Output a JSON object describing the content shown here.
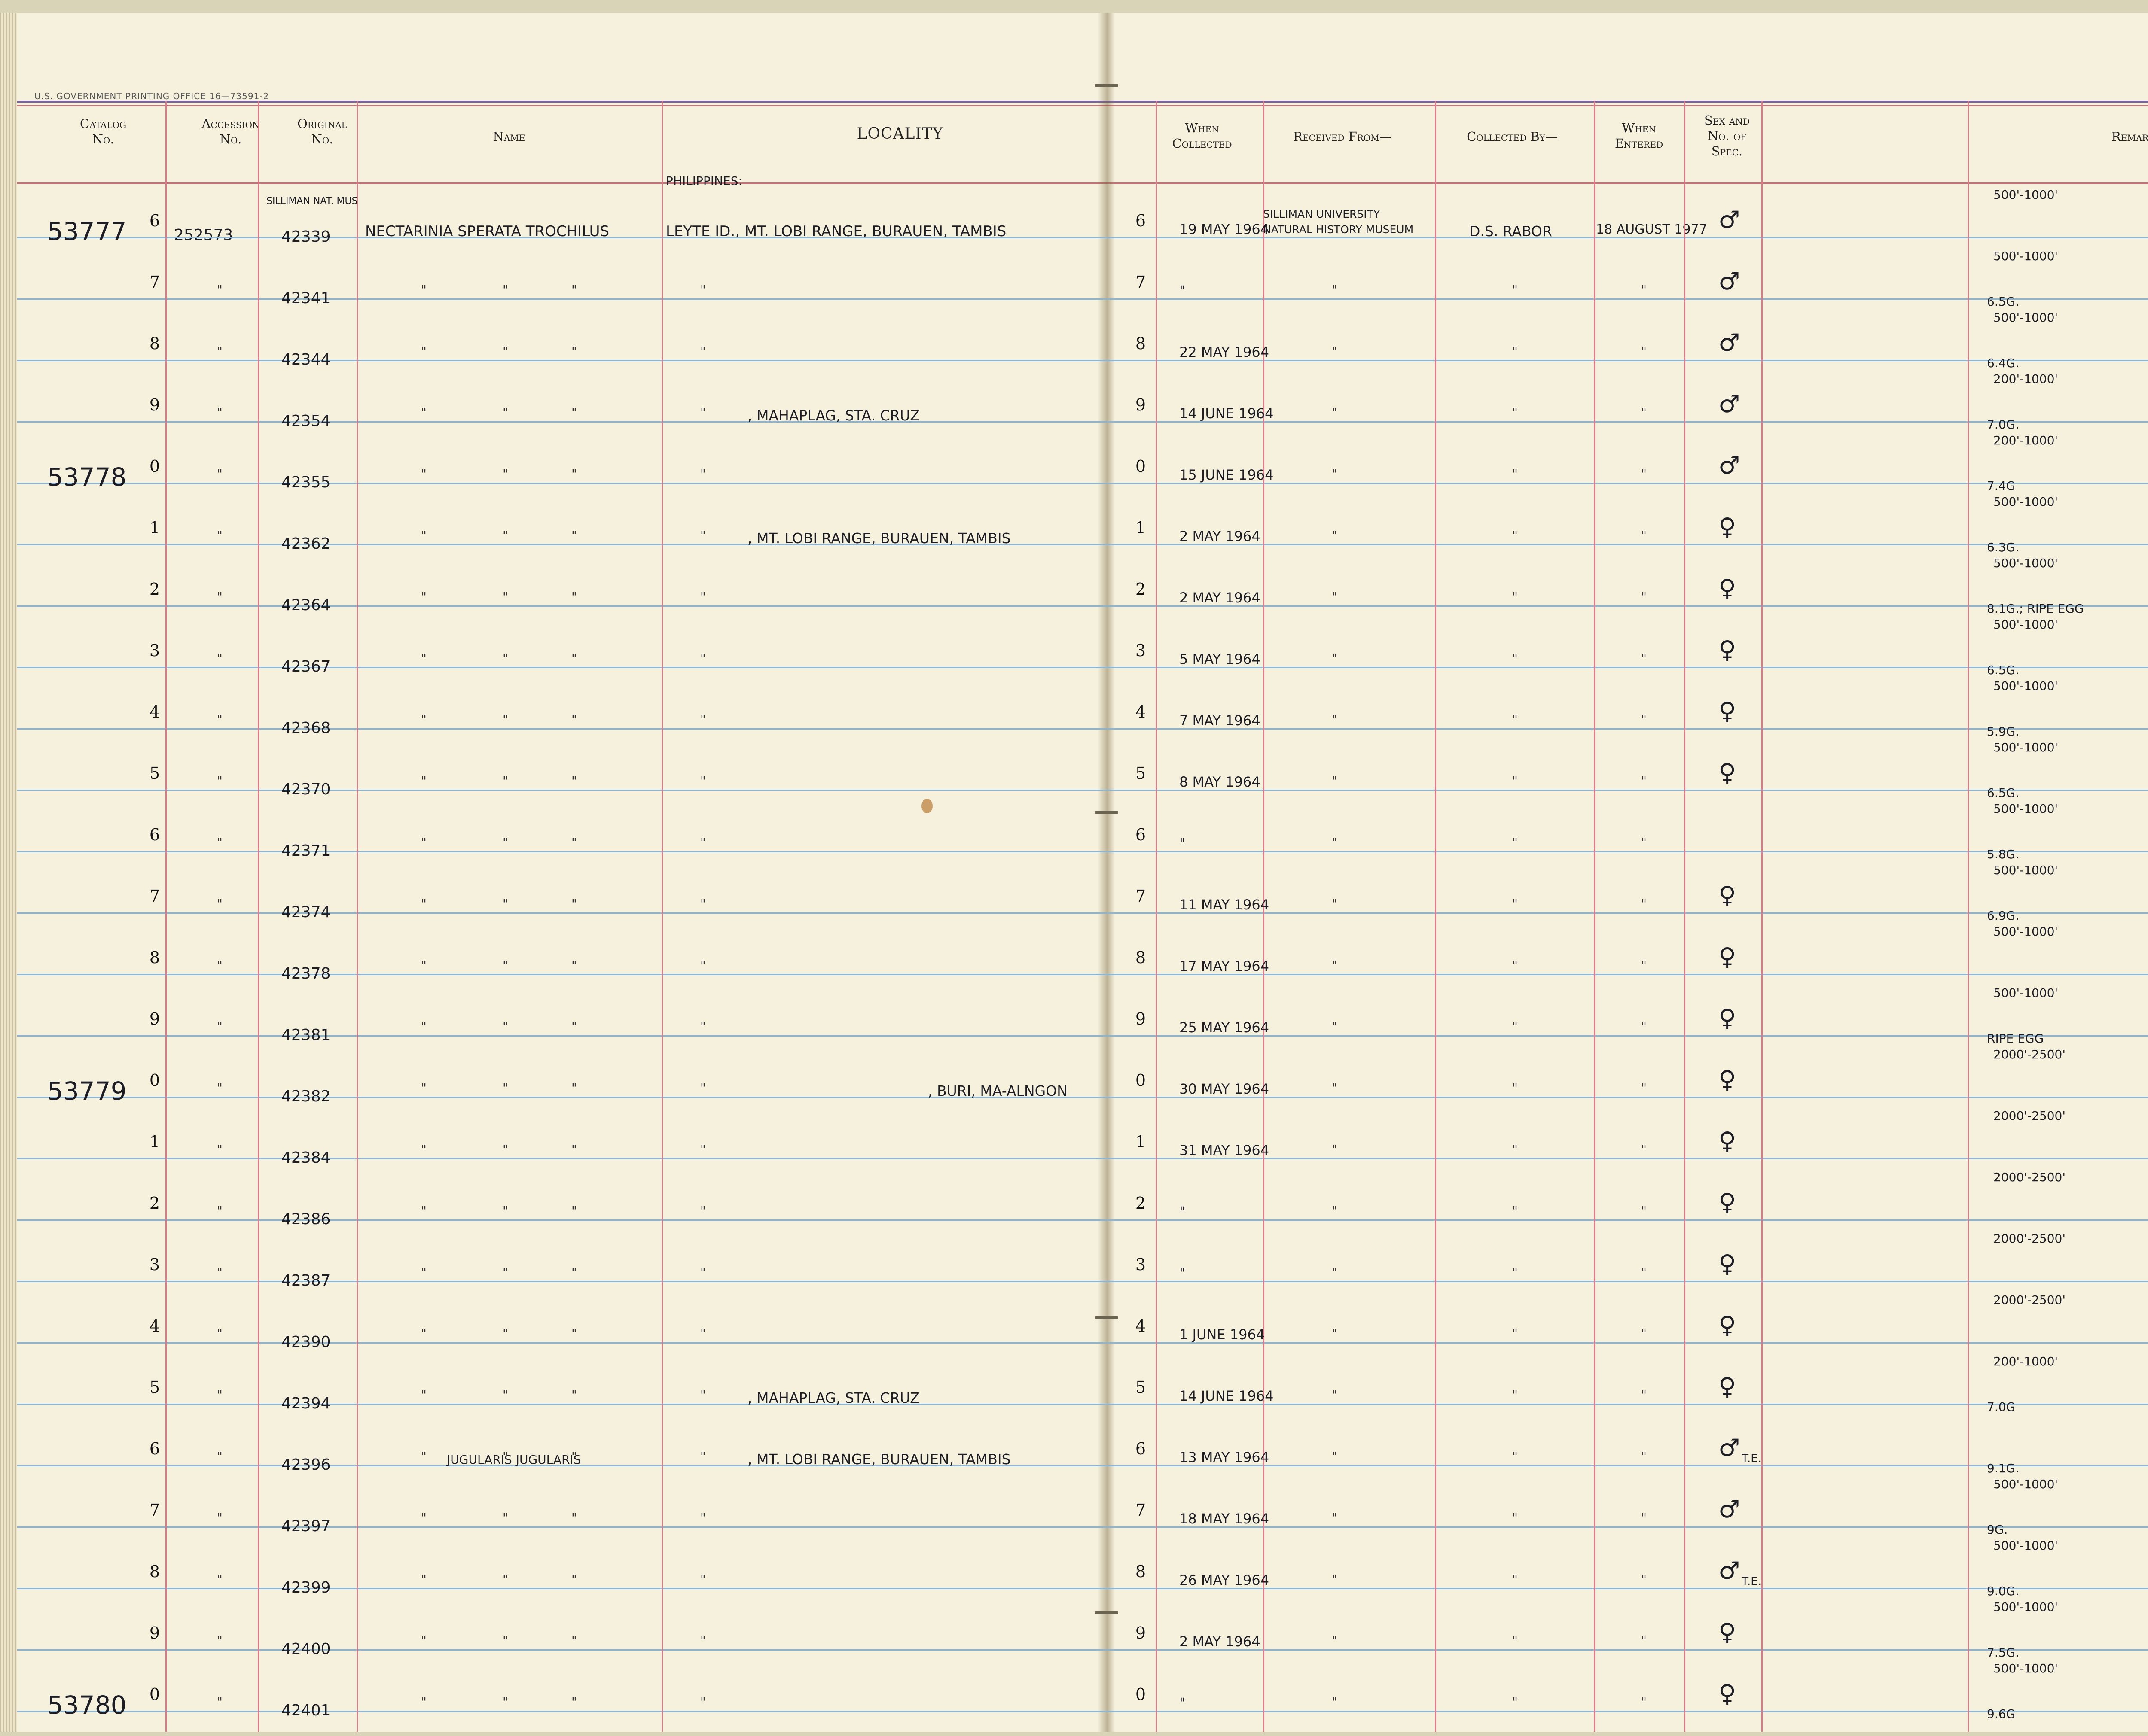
{
  "printer_line": "U.S. GOVERNMENT PRINTING OFFICE   16—73591-2",
  "headers": {
    "catalog": "Catalog\nNo.",
    "accession": "Accession\nNo.",
    "original": "Original\nNo.",
    "name": "Name",
    "locality": "LOCALITY",
    "when_collected": "When\nCollected",
    "received_from": "Received From—",
    "collected_by": "Collected By—",
    "when_entered": "When\nEntered",
    "sex": "Sex and\nNo. of\nSpec.",
    "remarks": "Remarks"
  },
  "top_notes": {
    "original_header_note": "SILLIMAN NAT. MUS",
    "locality_header_note": "PHILIPPINES:"
  },
  "first_row": {
    "accession": "252573",
    "name": "NECTARINIA SPERATA TROCHILUS",
    "locality": "LEYTE ID., MT. LOBI RANGE, BURAUEN, TAMBIS",
    "received_from_line1": "SILLIMAN UNIVERSITY",
    "received_from_line2": "NATURAL HISTORY MUSEUM",
    "collected_by": "D.S. RABOR",
    "when_entered": "18 AUGUST 1977"
  },
  "catalog_groups": [
    {
      "prefix": "53777",
      "row": 0
    },
    {
      "prefix": "53778",
      "row": 4
    },
    {
      "prefix": "53779",
      "row": 14
    },
    {
      "prefix": "53780",
      "row": 24
    }
  ],
  "locality_notes": [
    {
      "row": 3,
      "text": ", MAHAPLAG, STA. CRUZ"
    },
    {
      "row": 5,
      "text": ", MT. LOBI RANGE, BURAUEN, TAMBIS"
    },
    {
      "row": 14,
      "text": ", BURI, MA-ALNGON"
    },
    {
      "row": 19,
      "text": ", MAHAPLAG, STA. CRUZ"
    },
    {
      "row": 20,
      "text": ", MT. LOBI RANGE, BURAUEN, TAMBIS"
    }
  ],
  "name_notes": [
    {
      "row": 20,
      "text": "JUGULARIS    JUGULARIS"
    }
  ],
  "ditto_mark": "\"",
  "rows": [
    {
      "digit": "6",
      "original": "42339",
      "when_collected": "19 MAY 1964",
      "sex": "♂",
      "te": "",
      "remarks_top": "500'-1000'",
      "remarks": ""
    },
    {
      "digit": "7",
      "original": "42341",
      "when_collected": "\"",
      "sex": "♂",
      "te": "",
      "remarks_top": "500'-1000'",
      "remarks": "6.5G."
    },
    {
      "digit": "8",
      "original": "42344",
      "when_collected": "22 MAY 1964",
      "sex": "♂",
      "te": "",
      "remarks_top": "500'-1000'",
      "remarks": "6.4G."
    },
    {
      "digit": "9",
      "original": "42354",
      "when_collected": "14 JUNE 1964",
      "sex": "♂",
      "te": "",
      "remarks_top": "200'-1000'",
      "remarks": "7.0G."
    },
    {
      "digit": "0",
      "original": "42355",
      "when_collected": "15 JUNE 1964",
      "sex": "♂",
      "te": "",
      "remarks_top": "200'-1000'",
      "remarks": "7.4G"
    },
    {
      "digit": "1",
      "original": "42362",
      "when_collected": "2 MAY 1964",
      "sex": "♀",
      "te": "",
      "remarks_top": "500'-1000'",
      "remarks": "6.3G."
    },
    {
      "digit": "2",
      "original": "42364",
      "when_collected": "2 MAY 1964",
      "sex": "♀",
      "te": "",
      "remarks_top": "500'-1000'",
      "remarks": "8.1G.; RIPE EGG"
    },
    {
      "digit": "3",
      "original": "42367",
      "when_collected": "5 MAY 1964",
      "sex": "♀",
      "te": "",
      "remarks_top": "500'-1000'",
      "remarks": "6.5G."
    },
    {
      "digit": "4",
      "original": "42368",
      "when_collected": "7 MAY 1964",
      "sex": "♀",
      "te": "",
      "remarks_top": "500'-1000'",
      "remarks": "5.9G."
    },
    {
      "digit": "5",
      "original": "42370",
      "when_collected": "8 MAY 1964",
      "sex": "♀",
      "te": "",
      "remarks_top": "500'-1000'",
      "remarks": "6.5G."
    },
    {
      "digit": "6",
      "original": "42371",
      "when_collected": "\"",
      "sex": "",
      "te": "",
      "remarks_top": "500'-1000'",
      "remarks": "5.8G."
    },
    {
      "digit": "7",
      "original": "42374",
      "when_collected": "11 MAY 1964",
      "sex": "♀",
      "te": "",
      "remarks_top": "500'-1000'",
      "remarks": "6.9G."
    },
    {
      "digit": "8",
      "original": "42378",
      "when_collected": "17 MAY 1964",
      "sex": "♀",
      "te": "",
      "remarks_top": "500'-1000'",
      "remarks": ""
    },
    {
      "digit": "9",
      "original": "42381",
      "when_collected": "25 MAY 1964",
      "sex": "♀",
      "te": "",
      "remarks_top": "500'-1000'",
      "remarks": "RIPE EGG"
    },
    {
      "digit": "0",
      "original": "42382",
      "when_collected": "30 MAY 1964",
      "sex": "♀",
      "te": "",
      "remarks_top": "2000'-2500'",
      "remarks": ""
    },
    {
      "digit": "1",
      "original": "42384",
      "when_collected": "31 MAY 1964",
      "sex": "♀",
      "te": "",
      "remarks_top": "2000'-2500'",
      "remarks": ""
    },
    {
      "digit": "2",
      "original": "42386",
      "when_collected": "\"",
      "sex": "♀",
      "te": "",
      "remarks_top": "2000'-2500'",
      "remarks": ""
    },
    {
      "digit": "3",
      "original": "42387",
      "when_collected": "\"",
      "sex": "♀",
      "te": "",
      "remarks_top": "2000'-2500'",
      "remarks": ""
    },
    {
      "digit": "4",
      "original": "42390",
      "when_collected": "1 JUNE 1964",
      "sex": "♀",
      "te": "",
      "remarks_top": "2000'-2500'",
      "remarks": ""
    },
    {
      "digit": "5",
      "original": "42394",
      "when_collected": "14 JUNE 1964",
      "sex": "♀",
      "te": "",
      "remarks_top": "200'-1000'",
      "remarks": "7.0G"
    },
    {
      "digit": "6",
      "original": "42396",
      "when_collected": "13 MAY 1964",
      "sex": "♂",
      "te": "T.E.",
      "remarks_top": "",
      "remarks": "9.1G."
    },
    {
      "digit": "7",
      "original": "42397",
      "when_collected": "18 MAY 1964",
      "sex": "♂",
      "te": "",
      "remarks_top": "500'-1000'",
      "remarks": "9G."
    },
    {
      "digit": "8",
      "original": "42399",
      "when_collected": "26 MAY 1964",
      "sex": "♂",
      "te": "T.E.",
      "remarks_top": "500'-1000'",
      "remarks": "9.0G."
    },
    {
      "digit": "9",
      "original": "42400",
      "when_collected": "2 MAY 1964",
      "sex": "♀",
      "te": "",
      "remarks_top": "500'-1000'",
      "remarks": "7.5G."
    },
    {
      "digit": "0",
      "original": "42401",
      "when_collected": "\"",
      "sex": "♀",
      "te": "",
      "remarks_top": "500'-1000'",
      "remarks": "9.6G"
    }
  ]
}
